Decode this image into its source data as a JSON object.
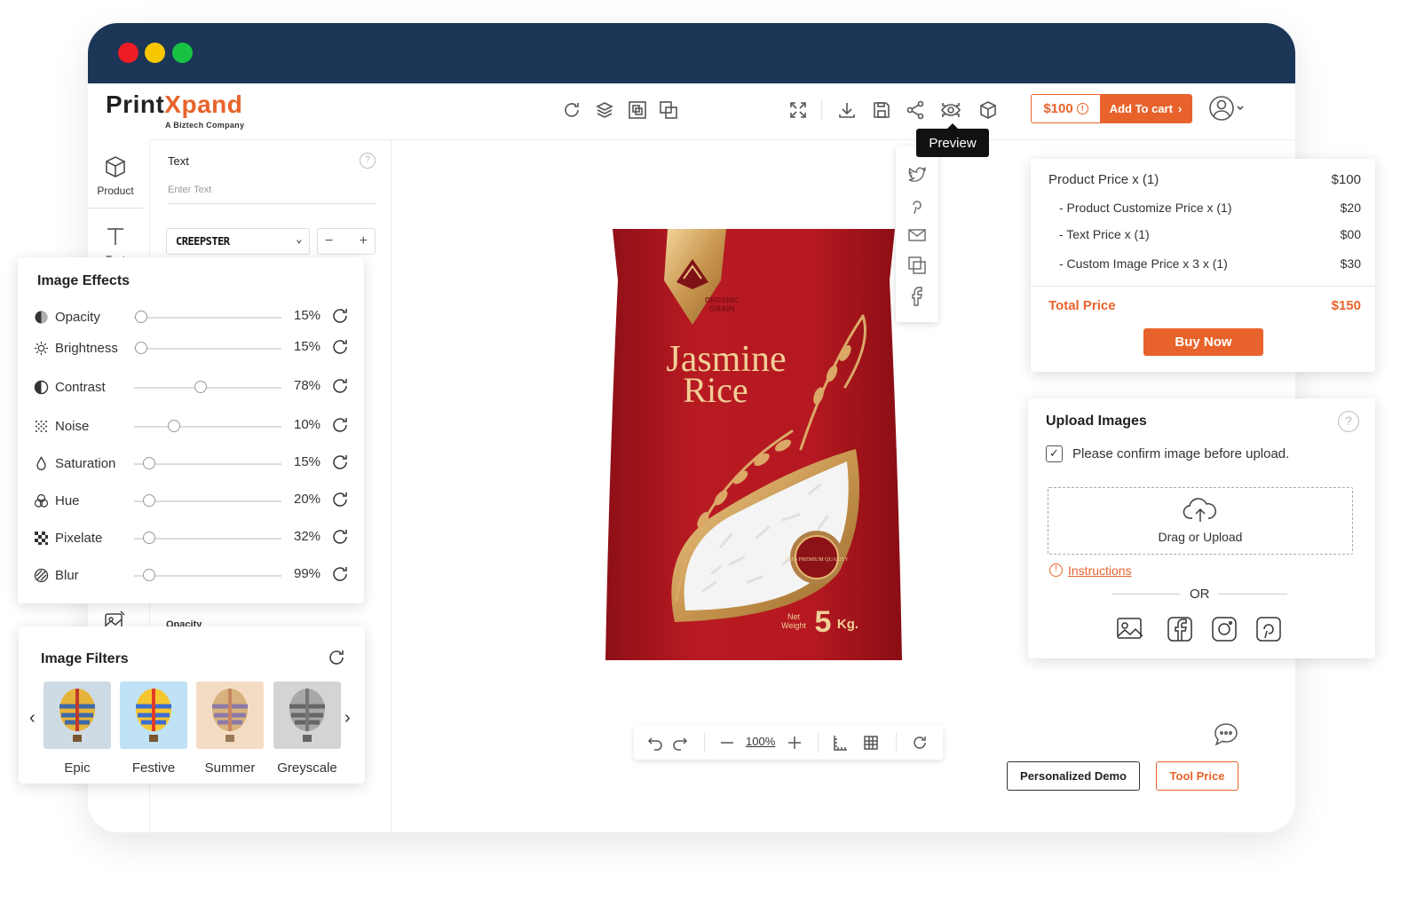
{
  "app": {
    "logo_main": "Print",
    "logo_x": "X",
    "logo_rest": "pand",
    "logo_sub": "A Biztech Company",
    "brand_color": "#e8632b",
    "titlebar_color": "#1b3657"
  },
  "toolbar": {
    "price": "$100",
    "add_to_cart": "Add To cart",
    "tooltip": "Preview",
    "icons": [
      "rotate-icon",
      "layers-icon",
      "group-icon",
      "ungroup-icon",
      "fullscreen-icon",
      "download-icon",
      "save-icon",
      "share-icon",
      "preview-eye-icon",
      "3d-view-icon",
      "user-icon"
    ]
  },
  "share_menu": [
    "twitter-icon",
    "pinterest-icon",
    "email-icon",
    "copy-icon",
    "facebook-icon"
  ],
  "leftnav": {
    "items": [
      {
        "label": "Product",
        "icon": "cube-icon"
      },
      {
        "label": "Text",
        "icon": "text-icon"
      }
    ]
  },
  "text_panel": {
    "label": "Text",
    "placeholder": "Enter Text",
    "font": "CREEPSTER",
    "partial_label": "Opacity"
  },
  "image_effects": {
    "title": "Image Effects",
    "rows": [
      {
        "name": "Opacity",
        "value": "15%",
        "level": 0.05,
        "icon": "opacity-icon"
      },
      {
        "name": "Brightness",
        "value": "15%",
        "level": 0.05,
        "icon": "brightness-icon"
      },
      {
        "name": "Contrast",
        "value": "78%",
        "level": 0.45,
        "icon": "contrast-icon"
      },
      {
        "name": "Noise",
        "value": "10%",
        "level": 0.27,
        "icon": "noise-icon"
      },
      {
        "name": "Saturation",
        "value": "15%",
        "level": 0.1,
        "icon": "saturation-icon"
      },
      {
        "name": "Hue",
        "value": "20%",
        "level": 0.1,
        "icon": "hue-icon"
      },
      {
        "name": "Pixelate",
        "value": "32%",
        "level": 0.1,
        "icon": "pixelate-icon"
      },
      {
        "name": "Blur",
        "value": "99%",
        "level": 0.1,
        "icon": "blur-icon"
      }
    ]
  },
  "image_filters": {
    "title": "Image Filters",
    "items": [
      {
        "name": "Epic"
      },
      {
        "name": "Festive"
      },
      {
        "name": "Summer"
      },
      {
        "name": "Greyscale"
      }
    ]
  },
  "product": {
    "brand_line1": "ORGANIC",
    "brand_line2": "GRAIN",
    "name_line1": "Jasmine",
    "name_line2": "Rice",
    "seal": "100% PREMIUM QUALITY",
    "weight_label1": "Net",
    "weight_label2": "Weight",
    "weight_value": "5",
    "weight_unit": "Kg."
  },
  "bottom_toolbar": {
    "zoom": "100%"
  },
  "pricing": {
    "rows": [
      {
        "label": "Product Price  x  (1)",
        "value": "$100"
      },
      {
        "label": "- Product Customize Price  x  (1)",
        "value": "$20"
      },
      {
        "label": "- Text Price x (1)",
        "value": "$00"
      },
      {
        "label": "- Custom Image Price x 3 x  (1)",
        "value": "$30"
      }
    ],
    "total_label": "Total Price",
    "total_value": "$150",
    "buy_now": "Buy Now"
  },
  "upload": {
    "title": "Upload Images",
    "confirm": "Please confirm image before upload.",
    "drop_text": "Drag or Upload",
    "instructions": "Instructions",
    "or": "OR",
    "sources": [
      "gallery-icon",
      "facebook-icon",
      "instagram-icon",
      "pinterest-icon"
    ]
  },
  "footer": {
    "demo": "Personalized Demo",
    "tool_price": "Tool Price"
  }
}
